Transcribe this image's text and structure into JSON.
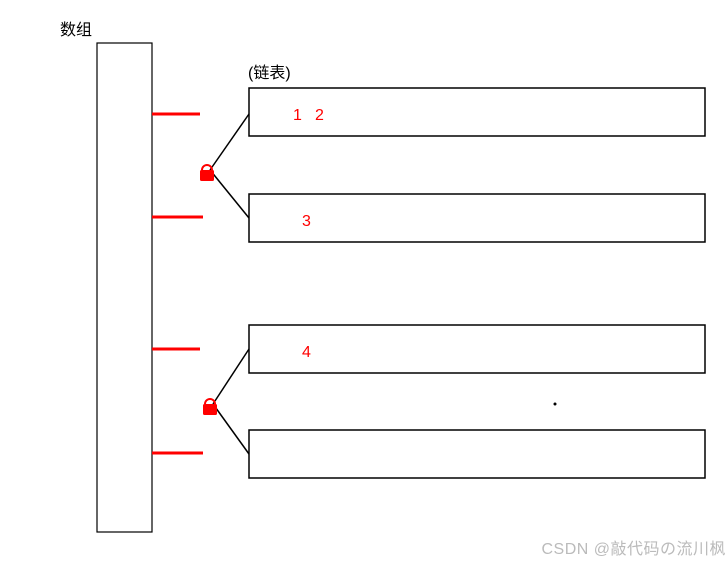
{
  "labels": {
    "array": "数组",
    "linkedList": "(链表)"
  },
  "values": {
    "box1_a": "1",
    "box1_b": "2",
    "box2": "3",
    "box3": "4"
  },
  "watermark": "CSDN @敲代码の流川枫",
  "colors": {
    "accent": "#ff0000",
    "stroke": "#000000"
  }
}
